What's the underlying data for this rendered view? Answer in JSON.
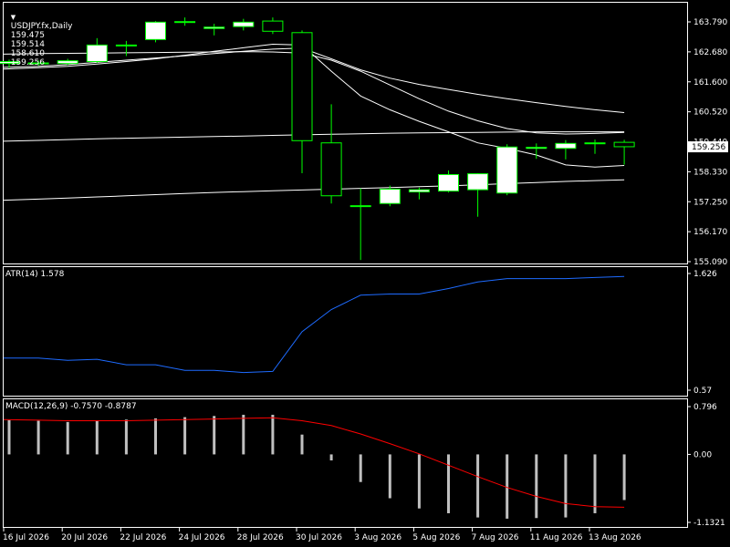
{
  "header": {
    "menu_icon": "triangle-down-icon",
    "symbol": "USDJPY.fx,Daily",
    "open": "159.475",
    "high": "159.514",
    "low": "158.610",
    "close": "159.256"
  },
  "price_axis": {
    "ticks": [
      "163.790",
      "162.680",
      "161.600",
      "160.520",
      "159.440",
      "158.330",
      "157.250",
      "156.170",
      "155.090"
    ],
    "current_price_label": "159.256"
  },
  "atr": {
    "label": "ATR(14) 1.578",
    "axis_ticks": [
      "1.626",
      "0.57"
    ]
  },
  "macd": {
    "label": "MACD(12,26,9) -0.7570 -0.8787",
    "axis_ticks": [
      "0.796",
      "0.00",
      "-1.1321"
    ]
  },
  "date_labels": [
    "16 Jul 2026",
    "20 Jul 2026",
    "22 Jul 2026",
    "24 Jul 2026",
    "28 Jul 2026",
    "30 Jul 2026",
    "3 Aug 2026",
    "5 Aug 2026",
    "7 Aug 2026",
    "11 Aug 2026",
    "13 Aug 2026"
  ],
  "colors": {
    "background": "#000000",
    "grid_border": "#ffffff",
    "bull_candle": "#ffffff",
    "candle_outline": "#00ff00",
    "moving_average": "#ffffff",
    "atr_line": "#1e6bff",
    "macd_histogram": "#c0c0c0",
    "macd_signal": "#ff0000"
  },
  "chart_data": {
    "type": "candlestick",
    "price_range": [
      155.09,
      163.79
    ],
    "candles": [
      {
        "o": 162.28,
        "h": 162.42,
        "l": 162.12,
        "c": 162.35
      },
      {
        "o": 162.28,
        "h": 162.4,
        "l": 162.2,
        "c": 162.3
      },
      {
        "o": 162.28,
        "h": 162.45,
        "l": 162.22,
        "c": 162.38
      },
      {
        "o": 162.35,
        "h": 163.2,
        "l": 162.3,
        "c": 162.95
      },
      {
        "o": 162.95,
        "h": 163.1,
        "l": 162.55,
        "c": 162.95
      },
      {
        "o": 163.15,
        "h": 163.82,
        "l": 163.05,
        "c": 163.78
      },
      {
        "o": 163.78,
        "h": 163.95,
        "l": 163.65,
        "c": 163.8
      },
      {
        "o": 163.55,
        "h": 163.72,
        "l": 163.3,
        "c": 163.6
      },
      {
        "o": 163.62,
        "h": 163.9,
        "l": 163.48,
        "c": 163.78
      },
      {
        "o": 163.82,
        "h": 163.95,
        "l": 163.35,
        "c": 163.45
      },
      {
        "o": 163.4,
        "h": 163.48,
        "l": 158.3,
        "c": 159.48
      },
      {
        "o": 159.4,
        "h": 160.8,
        "l": 157.2,
        "c": 157.48
      },
      {
        "o": 157.1,
        "h": 157.75,
        "l": 155.15,
        "c": 157.12
      },
      {
        "o": 157.2,
        "h": 157.85,
        "l": 157.1,
        "c": 157.72
      },
      {
        "o": 157.62,
        "h": 157.78,
        "l": 157.35,
        "c": 157.7
      },
      {
        "o": 157.65,
        "h": 158.4,
        "l": 157.6,
        "c": 158.25
      },
      {
        "o": 157.7,
        "h": 158.3,
        "l": 156.72,
        "c": 158.28
      },
      {
        "o": 157.58,
        "h": 159.35,
        "l": 157.5,
        "c": 159.25
      },
      {
        "o": 159.2,
        "h": 159.38,
        "l": 158.82,
        "c": 159.24
      },
      {
        "o": 159.2,
        "h": 159.5,
        "l": 158.8,
        "c": 159.38
      },
      {
        "o": 159.38,
        "h": 159.52,
        "l": 159.0,
        "c": 159.4
      },
      {
        "o": 159.42,
        "h": 159.51,
        "l": 158.61,
        "c": 159.26
      }
    ],
    "ma_series": [
      {
        "values": [
          162.08,
          162.13,
          162.18,
          162.26,
          162.35,
          162.45,
          162.58,
          162.72,
          162.85,
          162.98,
          162.95,
          162.0,
          161.1,
          160.6,
          160.18,
          159.8,
          159.4,
          159.2,
          158.96,
          158.6,
          158.52,
          158.58
        ]
      },
      {
        "values": [
          162.14,
          162.18,
          162.24,
          162.32,
          162.4,
          162.48,
          162.56,
          162.64,
          162.72,
          162.8,
          162.84,
          162.45,
          162.05,
          161.75,
          161.52,
          161.34,
          161.16,
          161.0,
          160.86,
          160.72,
          160.6,
          160.5
        ]
      },
      {
        "values": [
          162.62,
          162.64,
          162.65,
          162.66,
          162.67,
          162.68,
          162.69,
          162.7,
          162.71,
          162.7,
          162.66,
          162.4,
          162.0,
          161.5,
          161.0,
          160.55,
          160.2,
          159.92,
          159.76,
          159.72,
          159.74,
          159.78
        ]
      },
      {
        "values": [
          159.46,
          159.49,
          159.52,
          159.55,
          159.57,
          159.59,
          159.61,
          159.63,
          159.65,
          159.67,
          159.69,
          159.71,
          159.73,
          159.75,
          159.76,
          159.77,
          159.78,
          159.79,
          159.8,
          159.8,
          159.8,
          159.8
        ]
      },
      {
        "values": [
          157.32,
          157.36,
          157.4,
          157.44,
          157.48,
          157.52,
          157.56,
          157.6,
          157.63,
          157.66,
          157.69,
          157.72,
          157.75,
          157.78,
          157.81,
          157.84,
          157.88,
          157.92,
          157.96,
          158.0,
          158.03,
          158.06
        ]
      }
    ],
    "atr_range": [
      0.57,
      1.626
    ],
    "atr_values": [
      0.86,
      0.86,
      0.84,
      0.85,
      0.8,
      0.8,
      0.75,
      0.75,
      0.73,
      0.74,
      1.1,
      1.3,
      1.43,
      1.44,
      1.44,
      1.49,
      1.55,
      1.58,
      1.58,
      1.58,
      1.59,
      1.6
    ],
    "macd_range": [
      -1.1321,
      0.796
    ],
    "macd_hist": [
      0.57,
      0.56,
      0.54,
      0.56,
      0.58,
      0.6,
      0.62,
      0.64,
      0.66,
      0.66,
      0.33,
      -0.1,
      -0.46,
      -0.73,
      -0.9,
      -0.98,
      -1.05,
      -1.07,
      -1.06,
      -1.05,
      -0.98,
      -0.76
    ],
    "macd_signal": [
      0.58,
      0.57,
      0.56,
      0.56,
      0.56,
      0.57,
      0.58,
      0.59,
      0.6,
      0.61,
      0.56,
      0.48,
      0.34,
      0.18,
      0.01,
      -0.18,
      -0.37,
      -0.55,
      -0.7,
      -0.82,
      -0.87,
      -0.88
    ]
  }
}
